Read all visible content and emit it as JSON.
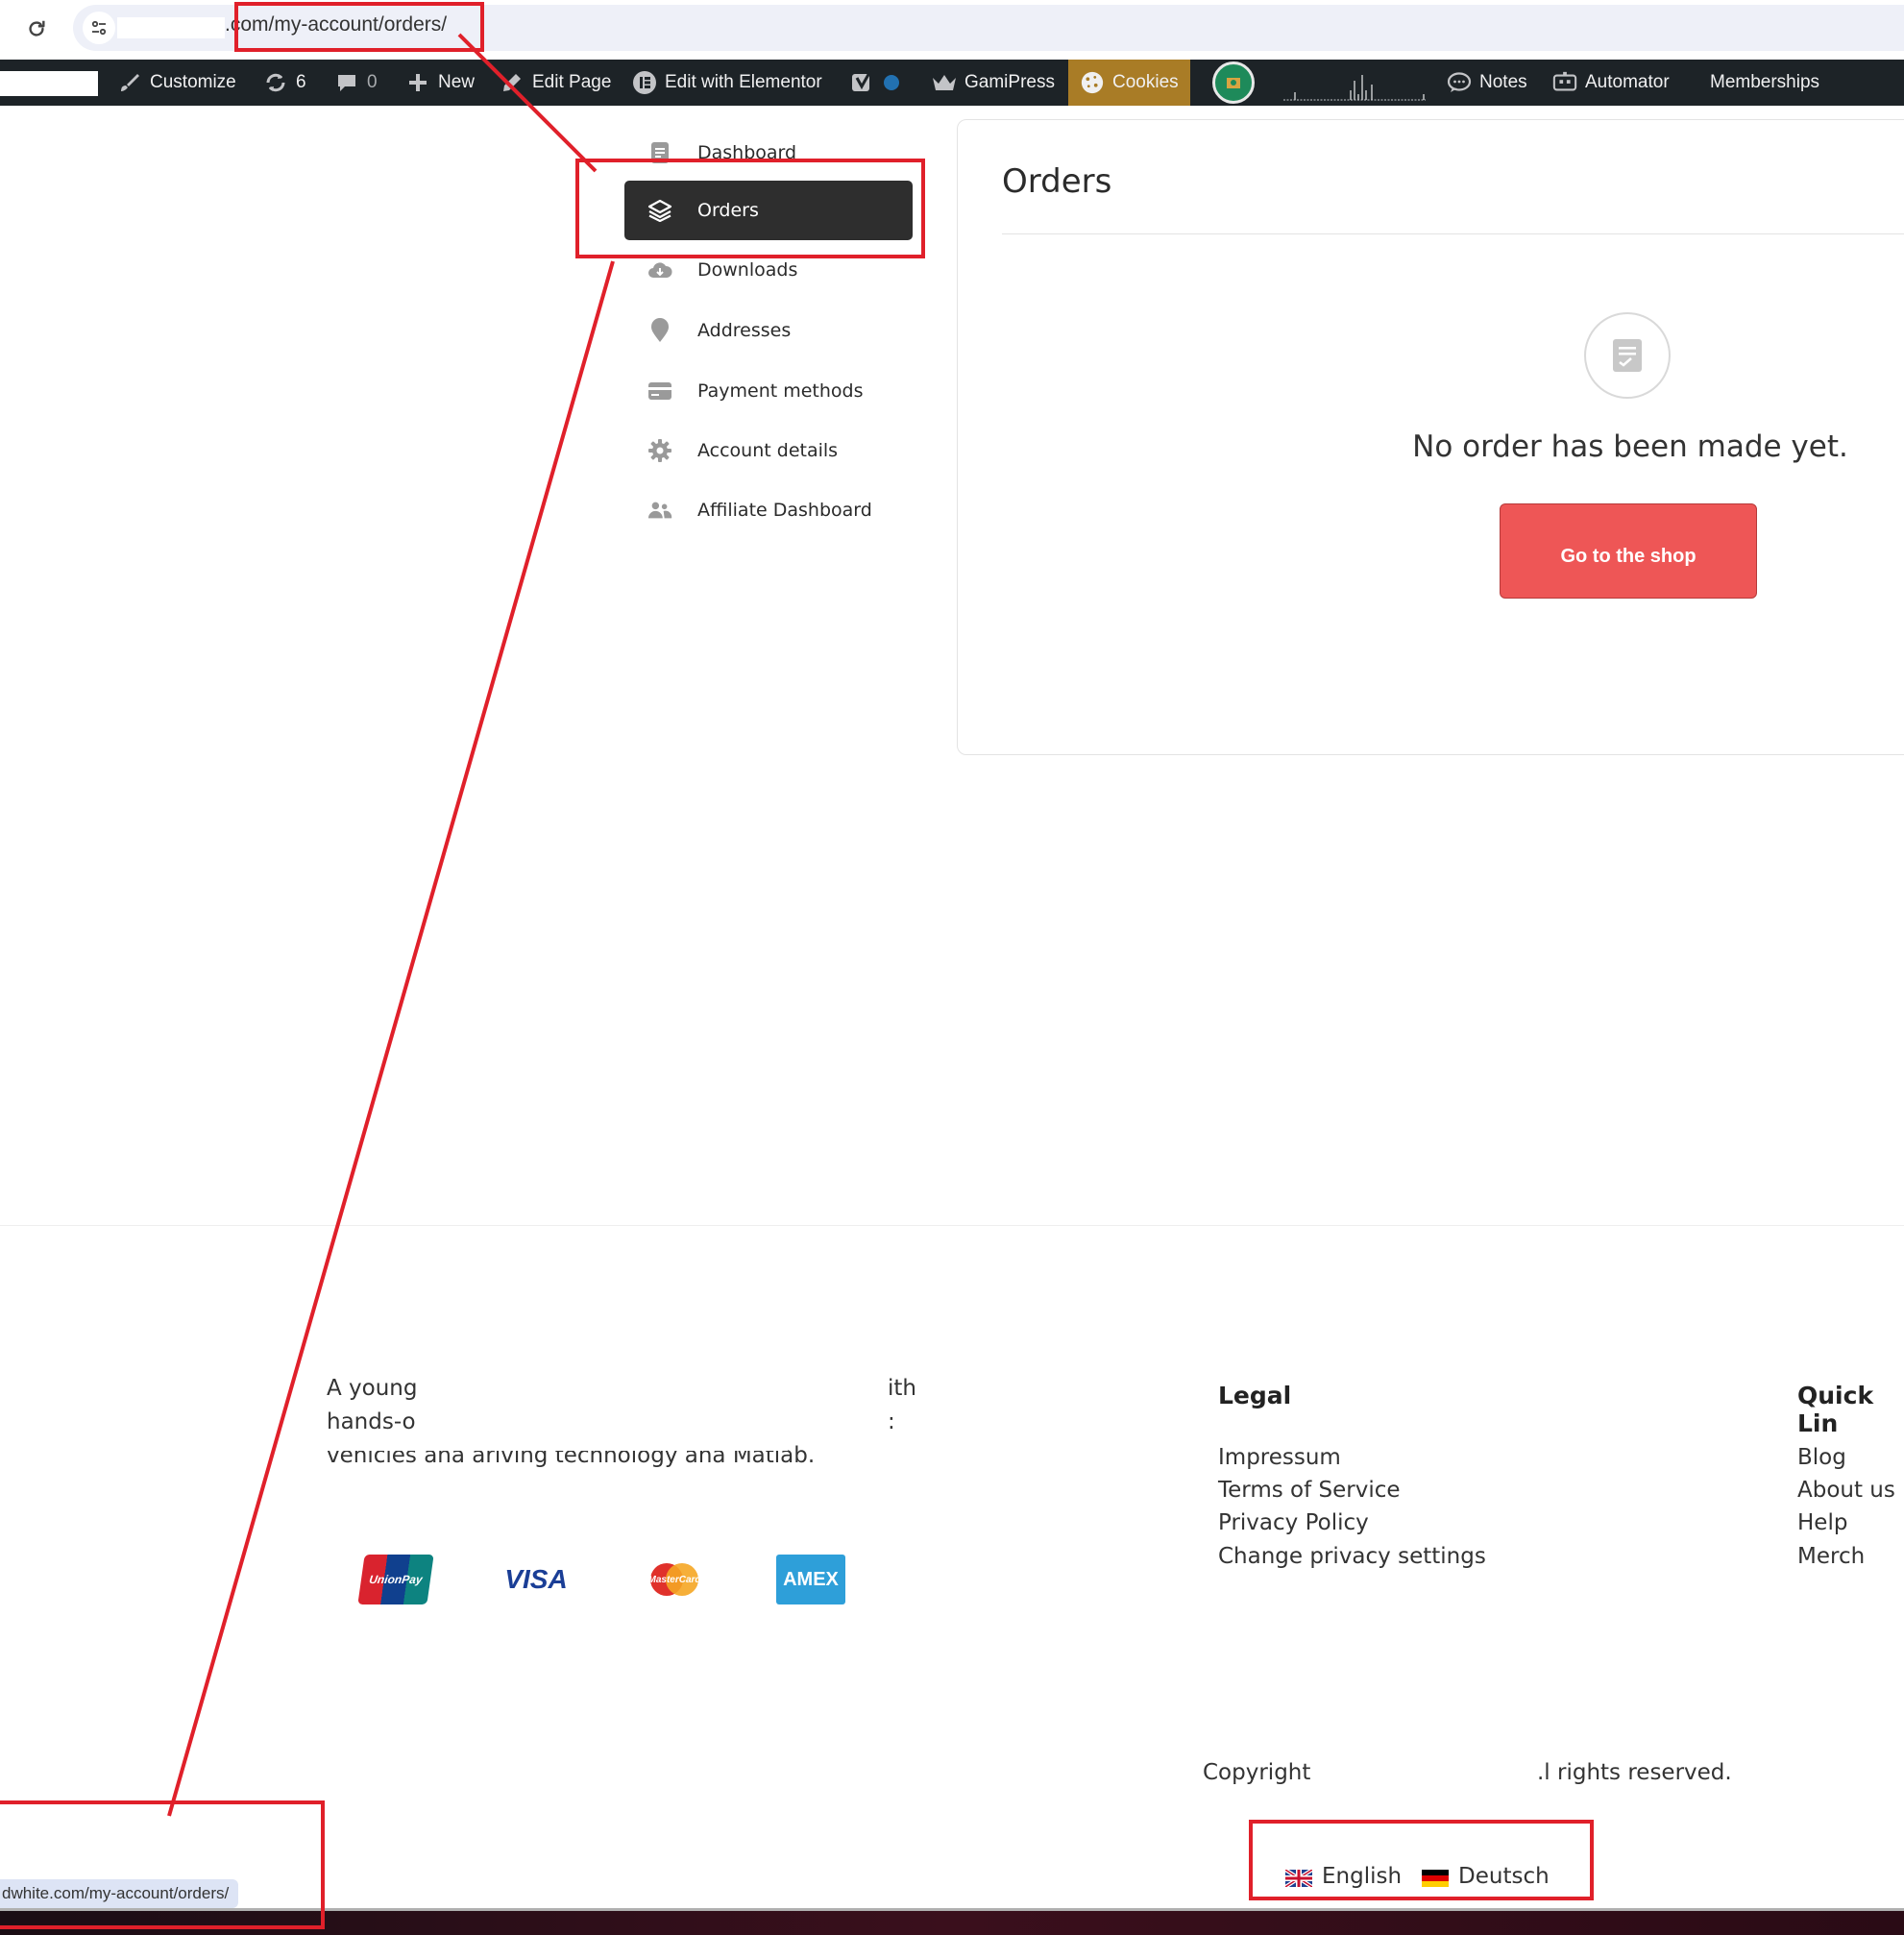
{
  "browser": {
    "url_suffix": ".com/my-account/orders/",
    "reload_icon": "reload-icon",
    "site_info_icon": "tune-icon"
  },
  "admin_bar": {
    "customize": "Customize",
    "updates_count": "6",
    "comments_count": "0",
    "new": "New",
    "edit_page": "Edit Page",
    "edit_elementor": "Edit with Elementor",
    "gamipress": "GamiPress",
    "cookies": "Cookies",
    "notes": "Notes",
    "automator": "Automator",
    "memberships": "Memberships",
    "colors": {
      "bar_bg": "#1d2327",
      "cookies_bg": "#a97c26",
      "status_dot": "#2271b1"
    }
  },
  "account_nav": {
    "items": [
      {
        "label": "Dashboard",
        "icon": "document-icon",
        "active": false
      },
      {
        "label": "Orders",
        "icon": "layers-icon",
        "active": true
      },
      {
        "label": "Downloads",
        "icon": "cloud-download-icon",
        "active": false
      },
      {
        "label": "Addresses",
        "icon": "map-pin-icon",
        "active": false
      },
      {
        "label": "Payment methods",
        "icon": "credit-card-icon",
        "active": false
      },
      {
        "label": "Account details",
        "icon": "gear-icon",
        "active": false
      },
      {
        "label": "Affiliate Dashboard",
        "icon": "users-icon",
        "active": false
      }
    ]
  },
  "orders": {
    "title": "Orders",
    "empty_message": "No order has been made yet.",
    "shop_button": "Go to the shop",
    "colors": {
      "button_bg": "#ee5656"
    }
  },
  "footer": {
    "about_line1_start": "A young",
    "about_line1_end": "ith",
    "about_line2_start": "hands-o",
    "about_line2_end": ":",
    "about_line3": "vehicles ana ariving tecnnology ana Matlab.",
    "payment_cards": [
      "UnionPay",
      "VISA",
      "MasterCard",
      "AMEX"
    ],
    "legal": {
      "heading": "Legal",
      "links": [
        "Impressum",
        "Terms of Service",
        "Privacy Policy",
        "Change privacy settings"
      ]
    },
    "quick_links": {
      "heading": "Quick Lin",
      "links": [
        "Blog",
        "About us",
        "Help",
        "Merch"
      ]
    },
    "copyright_start": "Copyright",
    "copyright_end": ".l rights reserved.",
    "languages": [
      "English",
      "Deutsch"
    ]
  },
  "status_bar": {
    "url": "dwhite.com/my-account/orders/"
  }
}
